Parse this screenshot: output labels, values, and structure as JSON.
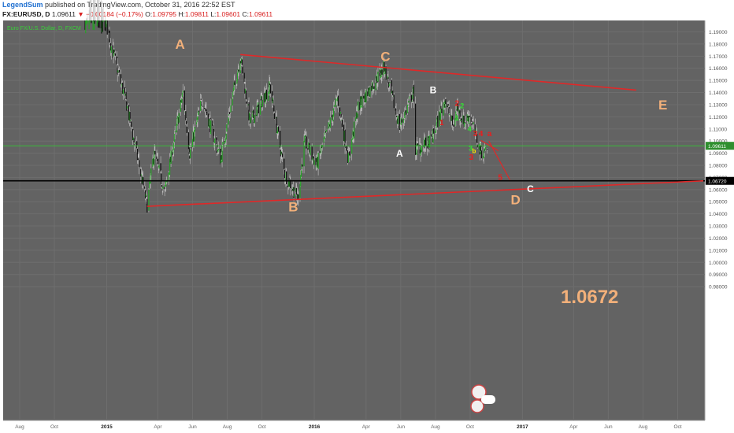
{
  "header": {
    "line1": {
      "user": "LegendSum",
      "text": "published on TradingView.com, October 31, 2016 22:52 EST"
    },
    "line2": {
      "symbol": "FX:EURUSD, D",
      "price": "1.09611",
      "change": "▼ −0.00184 (−0.17%)",
      "o_label": "O:",
      "o_value": "1.09795",
      "h_label": "H:",
      "h_value": "1.09811",
      "l_label": "L:",
      "l_value": "1.09601",
      "c_label": "C:",
      "c_value": "1.09611"
    }
  },
  "chart_data": {
    "type": "candlestick",
    "instrument": "Euro FX/U.S. Dollar, D, FXCM",
    "y_ticks": [
      "1.19000",
      "1.18000",
      "1.17000",
      "1.16000",
      "1.15000",
      "1.14000",
      "1.13000",
      "1.12000",
      "1.11000",
      "1.10000",
      "1.09000",
      "1.08000",
      "1.07000",
      "1.06000",
      "1.05000",
      "1.04000",
      "1.03000",
      "1.02000",
      "1.01000",
      "1.00000",
      "0.99000",
      "0.98000"
    ],
    "x_ticks": [
      "Aug",
      "Oct",
      "2015",
      "Apr",
      "Jun",
      "Aug",
      "Oct",
      "2016",
      "Apr",
      "Jun",
      "Aug",
      "Oct",
      "2017",
      "Apr",
      "Jun",
      "Aug",
      "Oct"
    ],
    "ylim": [
      0.975,
      1.195
    ],
    "current_price": "1.09611",
    "horizontal_level": "1.06720",
    "big_label": "1.0672",
    "colors": {
      "background": "#636363",
      "up_candle": "#27a127",
      "down_candle": "#111111",
      "trendline": "#e02828",
      "wave_label_orange": "#f2b07a",
      "wave_label_white": "#ffffff",
      "wave_label_red": "#e81e1e",
      "wave_label_green": "#33e033",
      "wave_label_yellow": "#ffe600"
    },
    "trendlines": [
      {
        "name": "upper",
        "from": {
          "x": "2015-08-24",
          "y": 1.1713
        },
        "to": {
          "x": "2017-07-20",
          "y": 1.142
        }
      },
      {
        "name": "lower",
        "from": {
          "x": "2015-03-13",
          "y": 1.0462
        },
        "to": {
          "x": "2017-11-15",
          "y": 1.0672
        }
      }
    ],
    "projection": [
      {
        "x": "2016-10-20",
        "y": 1.1005
      },
      {
        "x": "2016-11-20",
        "y": 1.092
      },
      {
        "x": "2016-11-03",
        "y": 1.1
      },
      {
        "x": "2016-12-10",
        "y": 1.068
      }
    ],
    "wave_labels": [
      {
        "text": "A",
        "style": "orange_big",
        "x": "2015-05-10",
        "y": 1.176
      },
      {
        "text": "B",
        "style": "orange_big",
        "x": "2015-11-25",
        "y": 1.042
      },
      {
        "text": "C",
        "style": "orange_big",
        "x": "2016-05-05",
        "y": 1.166
      },
      {
        "text": "D",
        "style": "orange_big",
        "x": "2016-12-20",
        "y": 1.048
      },
      {
        "text": "E",
        "style": "orange_big",
        "x": "2017-09-05",
        "y": 1.126
      },
      {
        "text": "B",
        "style": "white",
        "x": "2016-07-28",
        "y": 1.1395
      },
      {
        "text": "A",
        "style": "white",
        "x": "2016-05-30",
        "y": 1.087
      },
      {
        "text": "C",
        "style": "white",
        "x": "2017-01-15",
        "y": 1.058
      },
      {
        "text": "1",
        "style": "red",
        "x": "2016-08-12",
        "y": 1.113
      },
      {
        "text": "2",
        "style": "red",
        "x": "2016-09-08",
        "y": 1.129
      },
      {
        "text": "2",
        "style": "green",
        "x": "2016-09-17",
        "y": 1.127
      },
      {
        "text": "1",
        "style": "green",
        "x": "2016-09-08",
        "y": 1.117
      },
      {
        "text": "4",
        "style": "green",
        "x": "2016-09-30",
        "y": 1.108
      },
      {
        "text": "3",
        "style": "red",
        "x": "2016-10-10",
        "y": 1.104
      },
      {
        "text": "4",
        "style": "red",
        "x": "2016-10-20",
        "y": 1.104
      },
      {
        "text": "a",
        "style": "red",
        "x": "2016-11-04",
        "y": 1.104
      },
      {
        "text": "3",
        "style": "green",
        "x": "2016-10-02",
        "y": 1.092
      },
      {
        "text": "b",
        "style": "yellow",
        "x": "2016-10-08",
        "y": 1.09
      },
      {
        "text": "3",
        "style": "red",
        "x": "2016-10-03",
        "y": 1.0845
      },
      {
        "text": "5",
        "style": "red",
        "x": "2016-11-23",
        "y": 1.068
      }
    ]
  }
}
